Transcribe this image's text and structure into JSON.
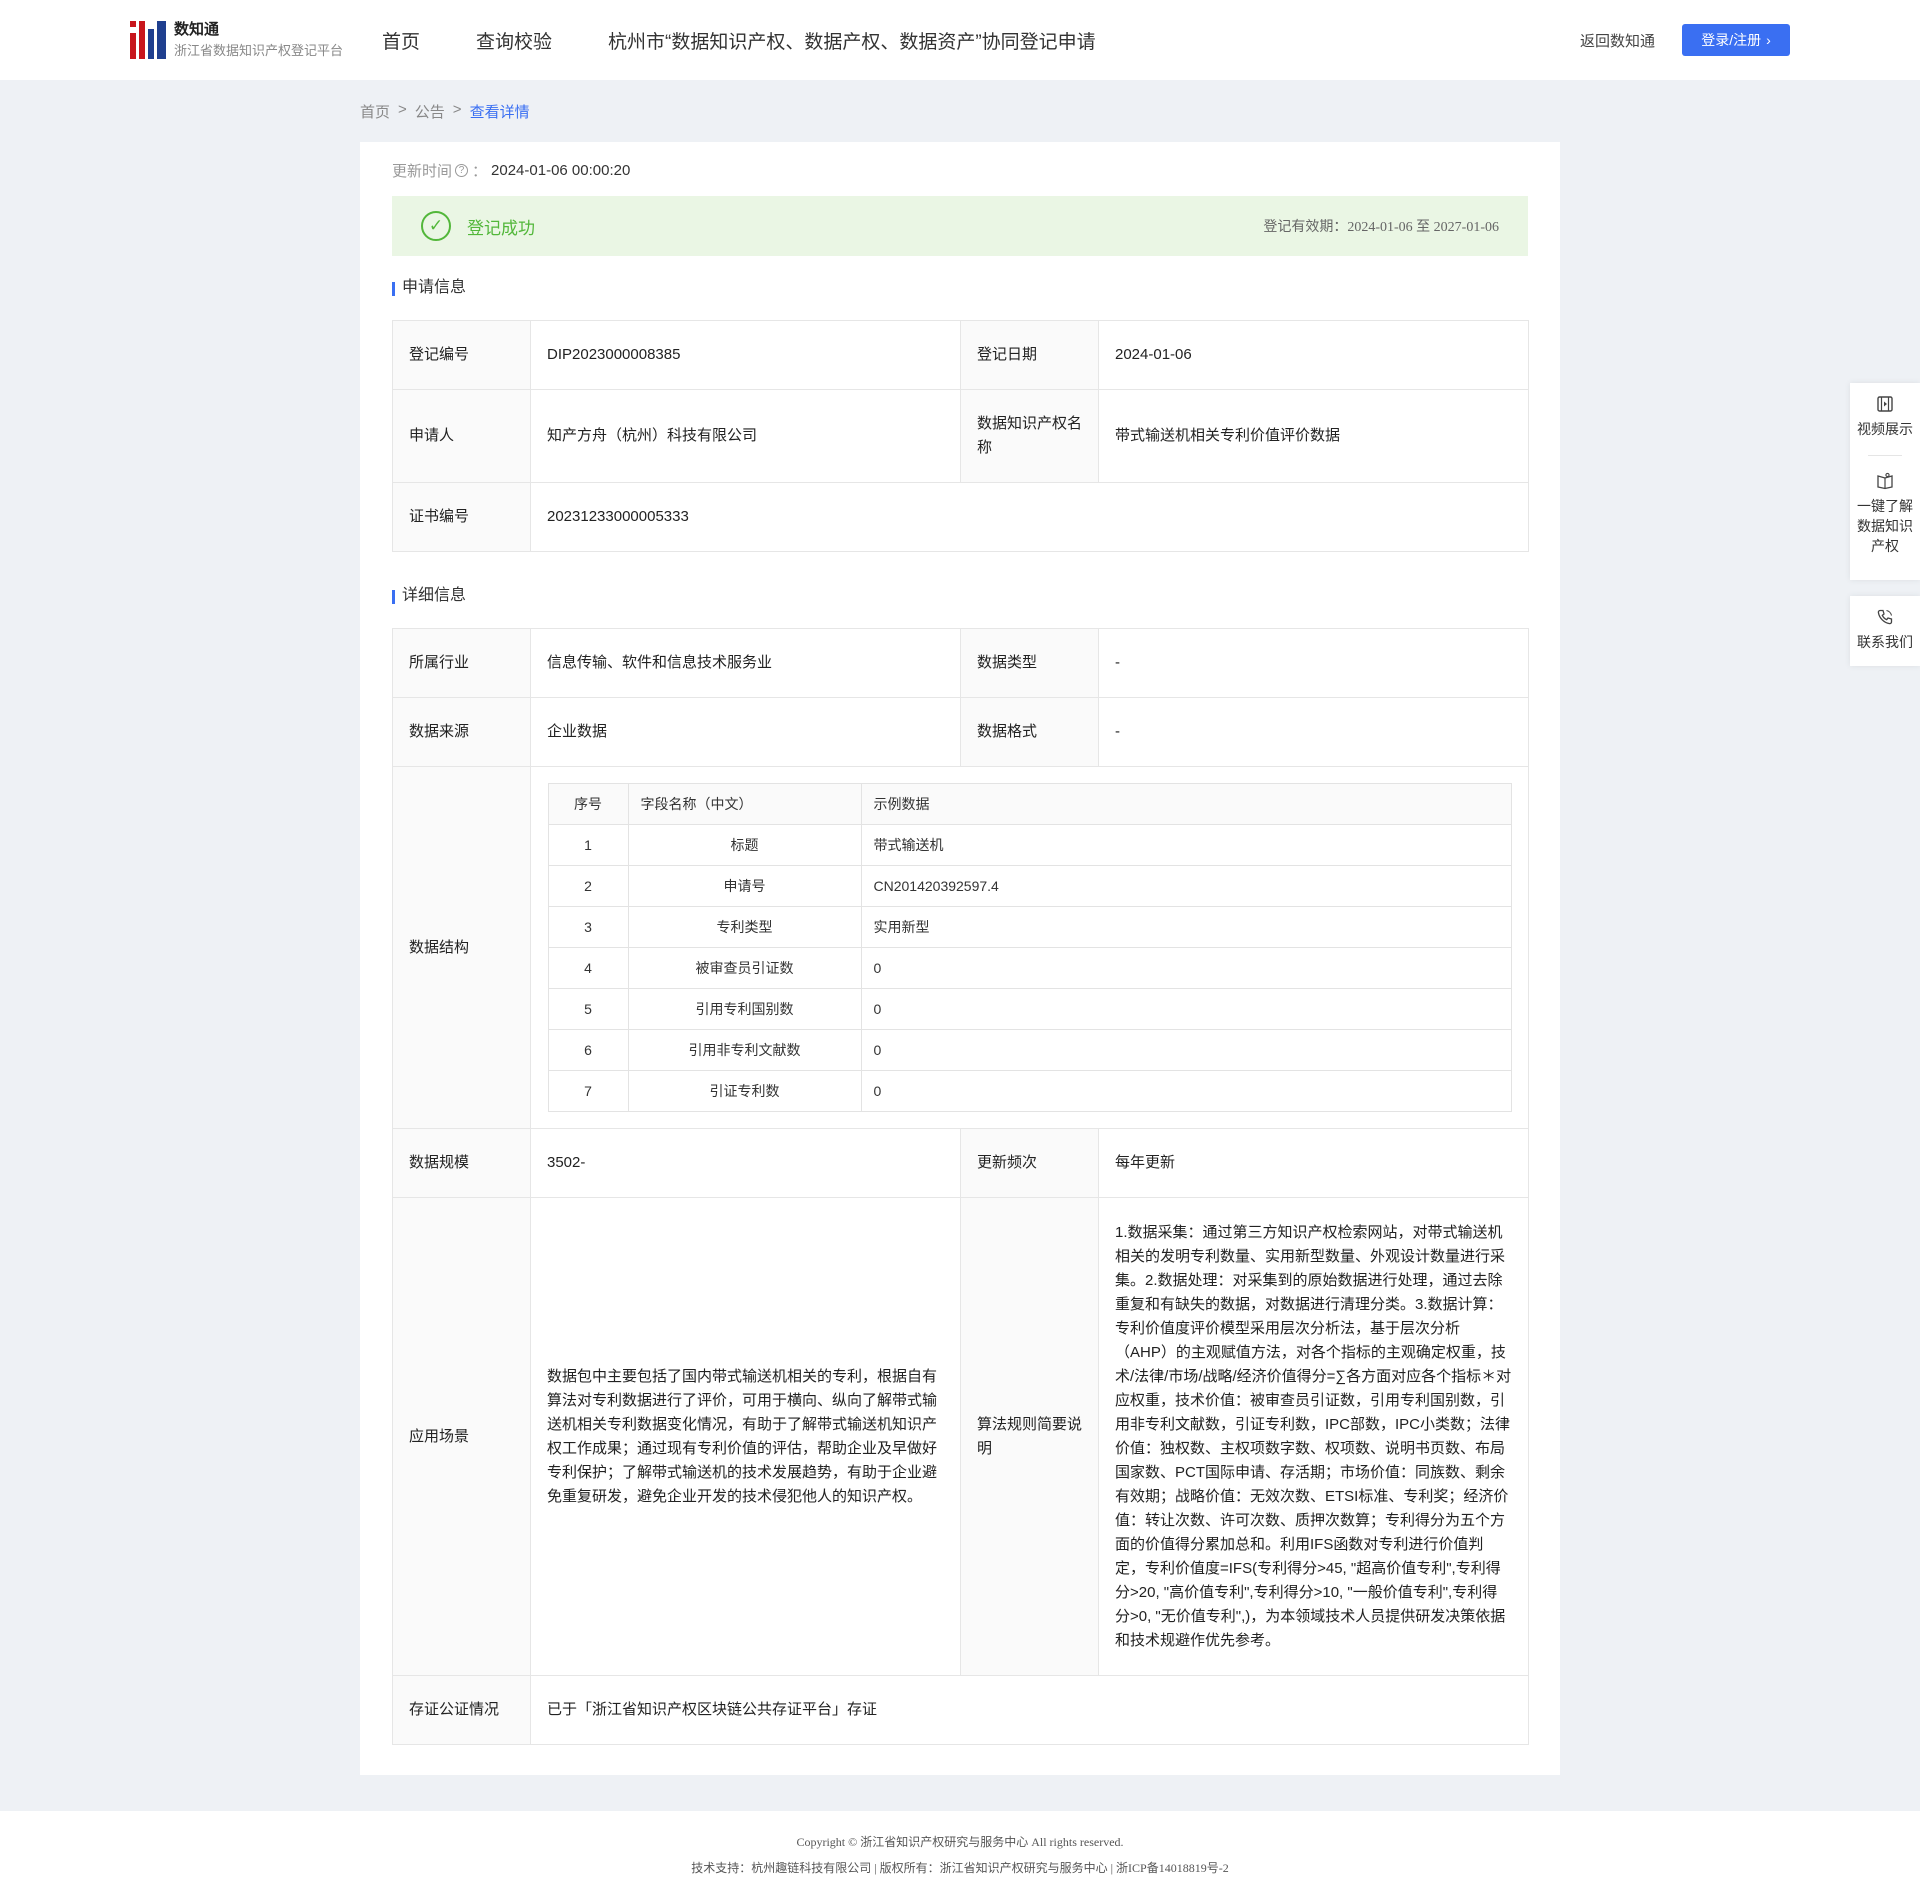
{
  "header": {
    "logo_title": "数知通",
    "logo_subtitle": "浙江省数据知识产权登记平台",
    "nav": [
      "首页",
      "查询校验",
      "杭州市“数据知识产权、数据产权、数据资产”协同登记申请"
    ],
    "back_label": "返回数知通",
    "login_label": "登录/注册"
  },
  "breadcrumb": [
    "首页",
    "公告",
    "查看详情"
  ],
  "update": {
    "label": "更新时间",
    "value": "2024-01-06 00:00:20"
  },
  "status": {
    "text": "登记成功",
    "validity": "登记有效期：2024-01-06 至 2027-01-06",
    "color": "#52b73a"
  },
  "application": {
    "title": "申请信息",
    "reg_no_label": "登记编号",
    "reg_no": "DIP2023000008385",
    "reg_date_label": "登记日期",
    "reg_date": "2024-01-06",
    "applicant_label": "申请人",
    "applicant": "知产方舟（杭州）科技有限公司",
    "ip_name_label": "数据知识产权名称",
    "ip_name": "带式输送机相关专利价值评价数据",
    "cert_no_label": "证书编号",
    "cert_no": "20231233000005333"
  },
  "detail": {
    "title": "详细信息",
    "industry_label": "所属行业",
    "industry": "信息传输、软件和信息技术服务业",
    "data_type_label": "数据类型",
    "data_type": "-",
    "source_label": "数据来源",
    "source": "企业数据",
    "format_label": "数据格式",
    "format": "-",
    "structure_label": "数据结构",
    "structure_headers": [
      "序号",
      "字段名称（中文）",
      "示例数据"
    ],
    "structure_rows": [
      [
        "1",
        "标题",
        "带式输送机"
      ],
      [
        "2",
        "申请号",
        "CN201420392597.4"
      ],
      [
        "3",
        "专利类型",
        "实用新型"
      ],
      [
        "4",
        "被审查员引证数",
        "0"
      ],
      [
        "5",
        "引用专利国别数",
        "0"
      ],
      [
        "6",
        "引用非专利文献数",
        "0"
      ],
      [
        "7",
        "引证专利数",
        "0"
      ]
    ],
    "scale_label": "数据规模",
    "scale": "3502-",
    "frequency_label": "更新频次",
    "frequency": "每年更新",
    "scenario_label": "应用场景",
    "scenario": "数据包中主要包括了国内带式输送机相关的专利，根据自有算法对专利数据进行了评价，可用于横向、纵向了解带式输送机相关专利数据变化情况，有助于了解带式输送机知识产权工作成果；通过现有专利价值的评估，帮助企业及早做好专利保护；了解带式输送机的技术发展趋势，有助于企业避免重复研发，避免企业开发的技术侵犯他人的知识产权。",
    "algorithm_label": "算法规则简要说明",
    "algorithm": "1.数据采集：通过第三方知识产权检索网站，对带式输送机相关的发明专利数量、实用新型数量、外观设计数量进行采集。2.数据处理：对采集到的原始数据进行处理，通过去除重复和有缺失的数据，对数据进行清理分类。3.数据计算：专利价值度评价模型采用层次分析法，基于层次分析（AHP）的主观赋值方法，对各个指标的主观确定权重，技术/法律/市场/战略/经济价值得分=∑各方面对应各个指标＊对应权重，技术价值：被审查员引证数，引用专利国别数，引用非专利文献数，引证专利数，IPC部数，IPC小类数；法律价值：独权数、主权项数字数、权项数、说明书页数、布局国家数、PCT国际申请、存活期；市场价值：同族数、剩余有效期；战略价值：无效次数、ETSI标准、专利奖；经济价值：转让次数、许可次数、质押次数算；专利得分为五个方面的价值得分累加总和。利用IFS函数对专利进行价值判定，专利价值度=IFS(专利得分>45, \"超高价值专利\",专利得分>20, \"高价值专利\",专利得分>10, \"一般价值专利\",专利得分>0, \"无价值专利\",)，为本领域技术人员提供研发决策依据和技术规避作优先参考。",
    "notary_label": "存证公证情况",
    "notary": "已于「浙江省知识产权区块链公共存证平台」存证"
  },
  "side": {
    "video": "视频展示",
    "learn": "一键了解数据知识产权",
    "contact": "联系我们"
  },
  "footer": {
    "copyright": "Copyright © 浙江省知识产权研究与服务中心 All rights reserved.",
    "support": "技术支持：杭州趣链科技有限公司 | 版权所有：浙江省知识产权研究与服务中心 | 浙ICP备14018819号-2"
  },
  "colors": {
    "accent": "#3a6ff2",
    "success_bg": "#eaf6e4",
    "page_bg": "#eef1f5"
  }
}
